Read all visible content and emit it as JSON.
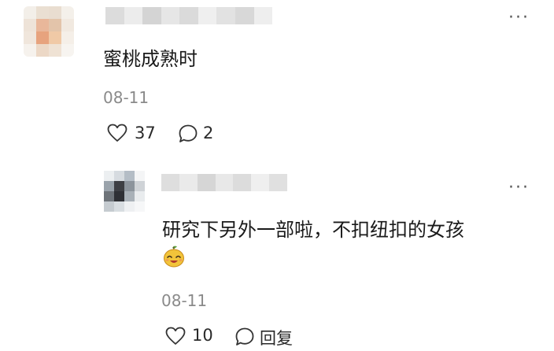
{
  "comments": [
    {
      "text": "蜜桃成熟时",
      "date": "08-11",
      "likes": "37",
      "replies": "2"
    },
    {
      "text": "研究下另外一部啦，不扣纽扣的女孩",
      "emoji_name": "smiling-orange-emoji",
      "date": "08-11",
      "likes": "10",
      "reply_label": "回复"
    }
  ],
  "more_glyph": "···"
}
